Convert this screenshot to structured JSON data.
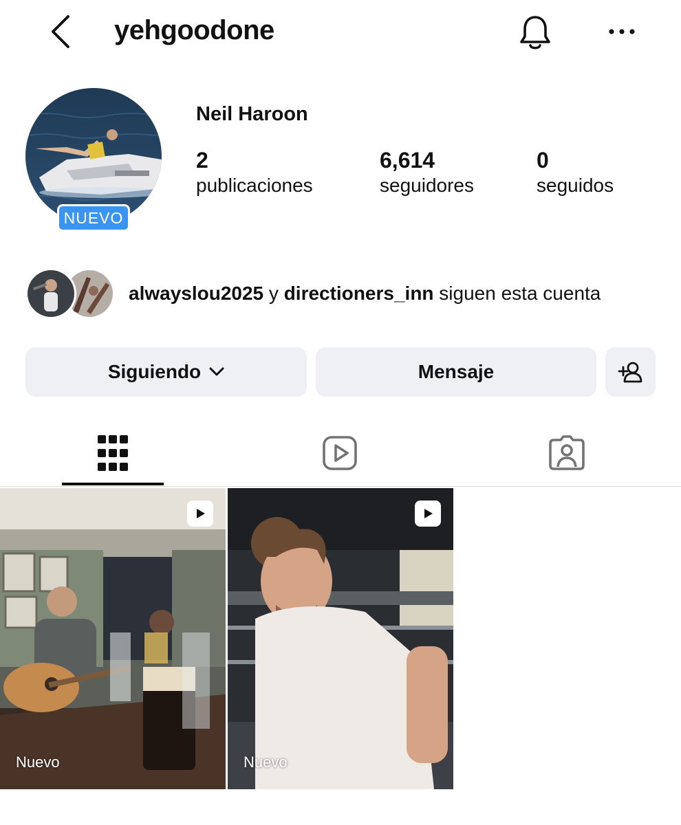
{
  "header": {
    "username": "yehgoodone",
    "back_icon": "chevron-left-icon",
    "notifications_icon": "bell-icon",
    "more_icon": "ellipsis-icon"
  },
  "profile": {
    "full_name": "Neil Haroon",
    "avatar_badge": "NUEVO",
    "stats": {
      "posts_count": "2",
      "posts_label": "publicaciones",
      "followers_count": "6,614",
      "followers_label": "seguidores",
      "following_count": "0",
      "following_label": "seguidos"
    }
  },
  "followed_by": {
    "user1": "alwayslou2025",
    "connector": " y ",
    "user2": "directioners_inn",
    "suffix": " siguen esta cuenta"
  },
  "actions": {
    "following_label": "Siguiendo",
    "message_label": "Mensaje",
    "add_person_icon": "add-person-icon"
  },
  "tabs": [
    {
      "name": "posts-grid",
      "icon": "grid-icon",
      "active": true
    },
    {
      "name": "reels",
      "icon": "reels-icon",
      "active": false
    },
    {
      "name": "tagged",
      "icon": "tagged-icon",
      "active": false
    }
  ],
  "posts": [
    {
      "label": "Nuevo",
      "type": "reel"
    },
    {
      "label": "Nuevo",
      "type": "reel"
    }
  ],
  "colors": {
    "badge_blue": "#3a94f0",
    "button_bg": "#eff0f3",
    "text": "#111111",
    "icon_gray": "#737373"
  }
}
